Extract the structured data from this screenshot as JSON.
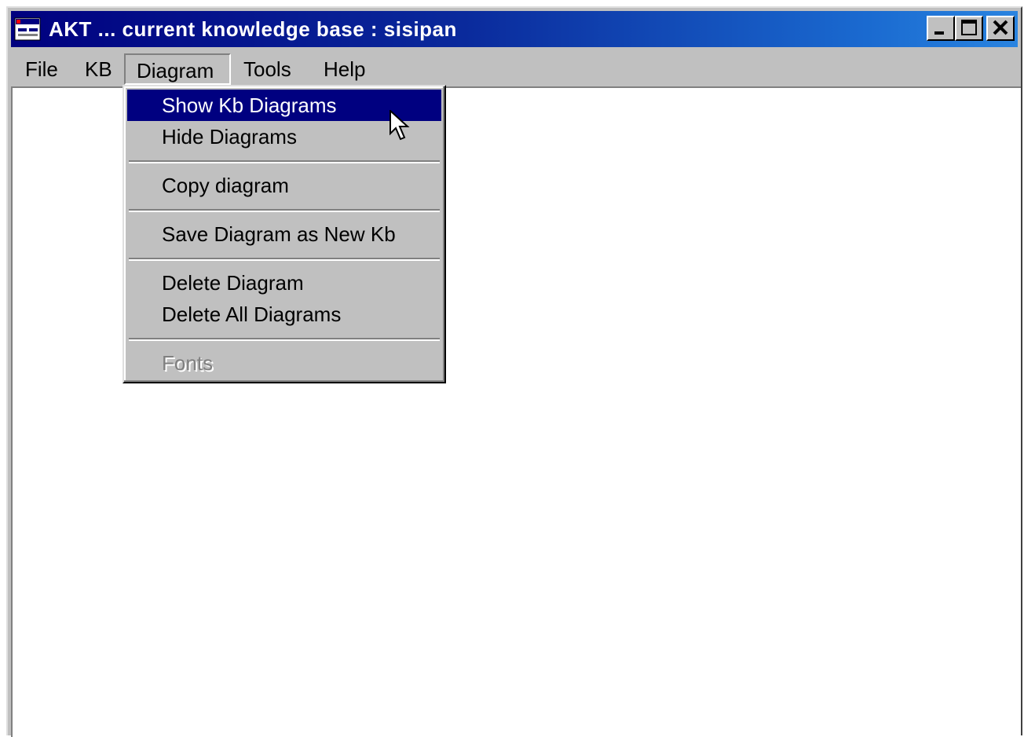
{
  "window": {
    "title": "AKT ... current knowledge base : sisipan",
    "controls": {
      "minimize": "minimize-icon",
      "maximize": "maximize-icon",
      "close": "close-icon"
    }
  },
  "menubar": {
    "items": [
      {
        "label": "File"
      },
      {
        "label": "KB"
      },
      {
        "label": "Diagram",
        "open": true
      },
      {
        "label": "Tools"
      },
      {
        "label": "Help"
      }
    ]
  },
  "diagram_menu": {
    "items": [
      {
        "label": "Show Kb Diagrams",
        "state": "highlighted"
      },
      {
        "label": "Hide Diagrams"
      },
      {
        "label": "Copy diagram"
      },
      {
        "label": "Save Diagram as New Kb"
      },
      {
        "label": "Delete Diagram"
      },
      {
        "label": "Delete All Diagrams"
      },
      {
        "label": "Fonts",
        "state": "disabled"
      }
    ]
  },
  "colors": {
    "title_bar_start": "#00007f",
    "title_bar_end": "#2a84e0",
    "highlight": "#000080",
    "face": "#c0c0c0"
  }
}
